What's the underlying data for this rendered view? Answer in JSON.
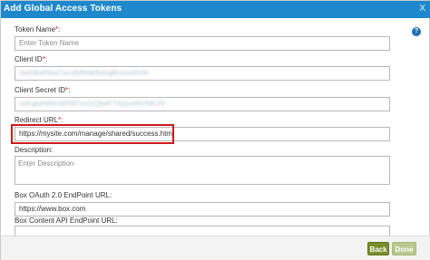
{
  "dialog": {
    "title": "Add Global Access Tokens",
    "close_icon": "X",
    "help_icon": "?"
  },
  "form": {
    "token_name": {
      "label": "Token Name",
      "required_mark": "*",
      "label_suffix": ":",
      "placeholder": "Enter Token Name"
    },
    "client_id": {
      "label": "Client ID",
      "required_mark": "*",
      "label_suffix": ":",
      "value": "xlwhlbxKbwj7ecxlbflhbk9xlhgBrxnxhhVln"
    },
    "client_secret": {
      "label": "Client Secret ID",
      "required_mark": "*",
      "label_suffix": ":",
      "value": "xxKqlwhWlmbPl9Txx2cQb4FT4zjxxtNVNKVV"
    },
    "redirect_url": {
      "label": "Redirect URL",
      "required_mark": "*",
      "label_suffix": ":",
      "value": "https://mysite.com/manage/shared/success.html"
    },
    "description": {
      "label": "Description:",
      "placeholder": "Enter Description"
    },
    "oauth_endpoint": {
      "label": "Box OAuth 2.0 EndPoint URL:",
      "value": "https://www.box.com"
    },
    "content_api_endpoint": {
      "label": "Box Content API EndPoint URL:"
    }
  },
  "footer": {
    "back_label": "Back",
    "done_label": "Done"
  },
  "colors": {
    "titlebar": "#1f88cc",
    "highlight": "#d01a1a",
    "back_button": "#7a8d2a",
    "done_button": "#b9c88d"
  }
}
